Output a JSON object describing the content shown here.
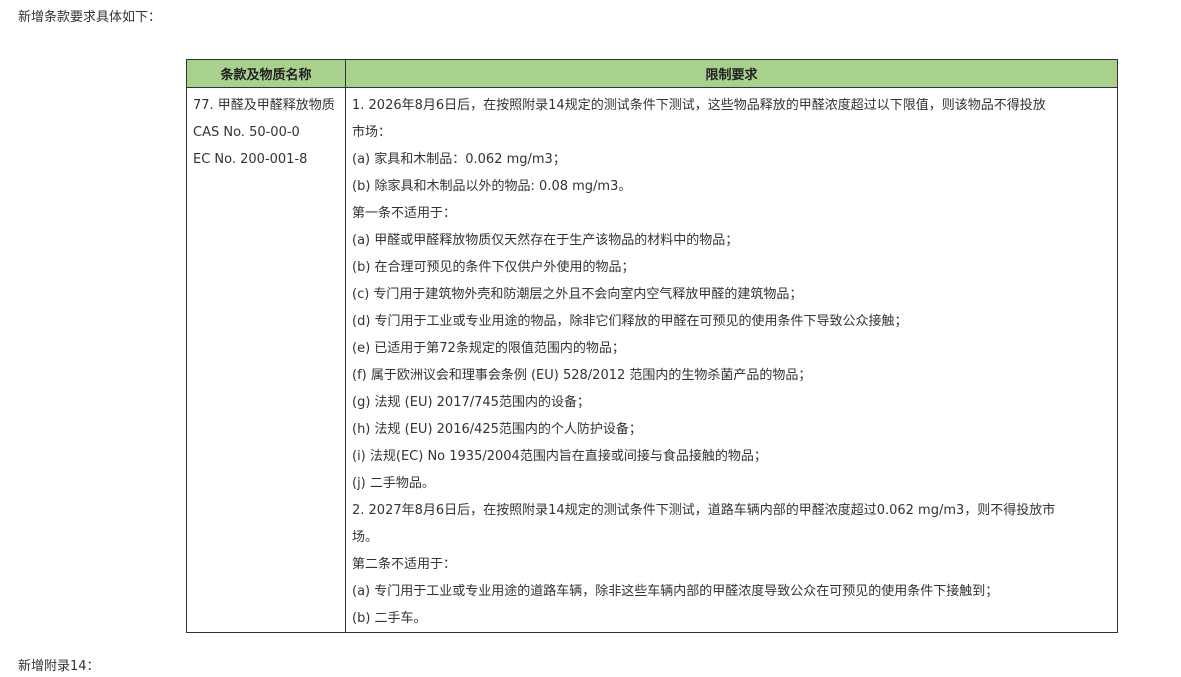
{
  "intro_text": "新增条款要求具体如下：",
  "outro_text": "新增附录14：",
  "table": {
    "headers": [
      "条款及物质名称",
      "限制要求"
    ],
    "substance": {
      "name": "77. 甲醛及甲醛释放物质",
      "cas": "CAS No. 50-00-0",
      "ec": "EC No. 200-001-8"
    },
    "requirements": {
      "p1_line1": "1. 2026年8月6日后，在按照附录14规定的测试条件下测试，这些物品释放的甲醛浓度超过以下限值，则该物品不得投放",
      "p1_line2": "市场：",
      "limit_a": "(a) 家具和木制品：0.062 mg/m3；",
      "limit_b": "(b) 除家具和木制品以外的物品: 0.08 mg/m3。",
      "exempt1_title": "第一条不适用于：",
      "exempt1": [
        "(a) 甲醛或甲醛释放物质仅天然存在于生产该物品的材料中的物品；",
        "(b) 在合理可预见的条件下仅供户外使用的物品；",
        "(c) 专门用于建筑物外壳和防潮层之外且不会向室内空气释放甲醛的建筑物品；",
        "(d) 专门用于工业或专业用途的物品，除非它们释放的甲醛在可预见的使用条件下导致公众接触；",
        "(e) 已适用于第72条规定的限值范围内的物品；",
        "(f) 属于欧洲议会和理事会条例 (EU) 528/2012 范围内的生物杀菌产品的物品；",
        "(g) 法规 (EU) 2017/745范围内的设备；",
        "(h) 法规 (EU) 2016/425范围内的个人防护设备；",
        "(i) 法规(EC) No 1935/2004范围内旨在直接或间接与食品接触的物品；",
        "(j) 二手物品。"
      ],
      "p2_line1": "2. 2027年8月6日后，在按照附录14规定的测试条件下测试，道路车辆内部的甲醛浓度超过0.062 mg/m3，则不得投放市",
      "p2_line2": "场。",
      "exempt2_title": "第二条不适用于：",
      "exempt2": [
        "(a) 专门用于工业或专业用途的道路车辆，除非这些车辆内部的甲醛浓度导致公众在可预见的使用条件下接触到；",
        "(b) 二手车。"
      ]
    }
  }
}
